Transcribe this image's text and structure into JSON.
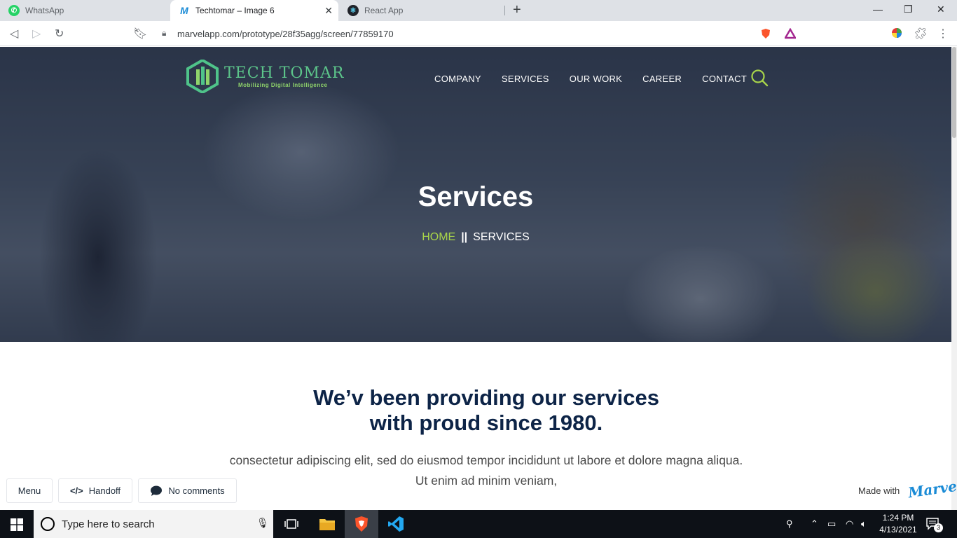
{
  "browser": {
    "tabs": [
      {
        "title": "WhatsApp",
        "active": false
      },
      {
        "title": "Techtomar – Image 6",
        "active": true
      },
      {
        "title": "React App",
        "active": false
      }
    ],
    "url": "marvelapp.com/prototype/28f35agg/screen/77859170"
  },
  "site": {
    "logo": {
      "name": "TECH TOMAR",
      "tagline": "Mobilizing Digital Intelligence"
    },
    "nav": [
      "COMPANY",
      "SERVICES",
      "OUR WORK",
      "CAREER",
      "CONTACT"
    ],
    "hero_title": "Services",
    "breadcrumb": {
      "home": "HOME",
      "separator": "||",
      "current": "SERVICES"
    },
    "headline_line1": "We’v been providing our services",
    "headline_line2": "with proud since 1980.",
    "paragraph": "consectetur adipiscing elit, sed do eiusmod tempor incididunt ut labore et dolore magna aliqua. Ut enim ad minim veniam,"
  },
  "marvel": {
    "menu_label": "Menu",
    "handoff_label": "Handoff",
    "comments_label": "No comments",
    "made_with": "Made with",
    "brand": "Marvel"
  },
  "taskbar": {
    "search_placeholder": "Type here to search",
    "time": "1:24 PM",
    "date": "4/13/2021",
    "notification_count": "3"
  },
  "colors": {
    "accent_green": "#a8d44a",
    "headline_navy": "#0d2447",
    "marvel_blue": "#1a8bd6"
  }
}
